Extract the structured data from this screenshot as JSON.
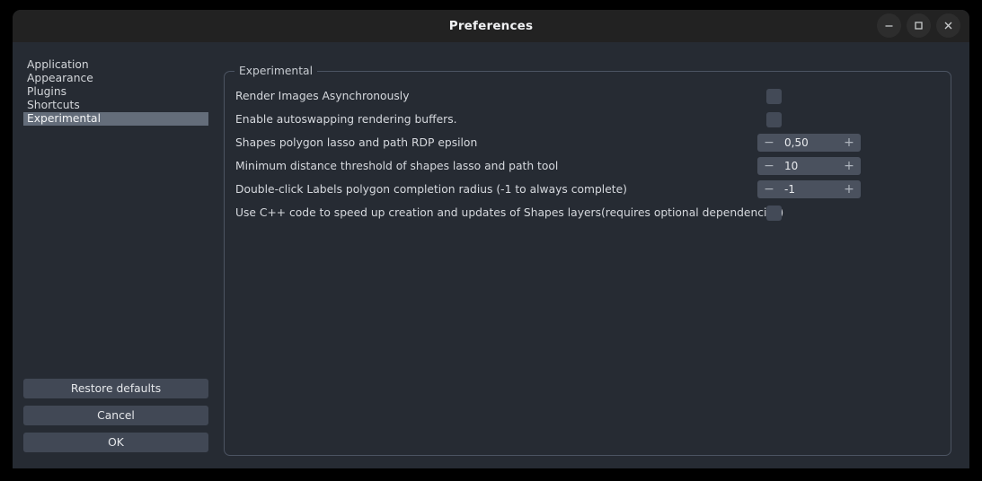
{
  "window": {
    "title": "Preferences",
    "controls": [
      {
        "name": "minimize",
        "glyph": "minimize-icon"
      },
      {
        "name": "maximize",
        "glyph": "maximize-icon"
      },
      {
        "name": "close",
        "glyph": "close-icon"
      }
    ]
  },
  "sidebar": {
    "items": [
      {
        "label": "Application",
        "selected": false
      },
      {
        "label": "Appearance",
        "selected": false
      },
      {
        "label": "Plugins",
        "selected": false
      },
      {
        "label": "Shortcuts",
        "selected": false
      },
      {
        "label": "Experimental",
        "selected": true
      }
    ]
  },
  "buttons": {
    "restore_defaults": "Restore defaults",
    "cancel": "Cancel",
    "ok": "OK"
  },
  "group": {
    "title": "Experimental",
    "rows": [
      {
        "label": "Render Images Asynchronously",
        "control": "checkbox",
        "checked": false
      },
      {
        "label": "Enable autoswapping rendering buffers.",
        "control": "checkbox",
        "checked": false
      },
      {
        "label": "Shapes polygon lasso and path RDP epsilon",
        "control": "spinbox",
        "value": "0,50",
        "decrement": "−",
        "increment": "+"
      },
      {
        "label": "Minimum distance threshold of shapes lasso and path tool",
        "control": "spinbox",
        "value": "10",
        "decrement": "−",
        "increment": "+"
      },
      {
        "label": "Double-click Labels polygon completion radius (-1 to always complete)",
        "control": "spinbox",
        "value": "-1",
        "decrement": "−",
        "increment": "+"
      },
      {
        "label": "Use C++ code to speed up creation and updates of Shapes layers(requires optional dependencies)",
        "control": "checkbox",
        "checked": false
      }
    ]
  },
  "colors": {
    "window_bg": "#262b33",
    "titlebar_bg": "#222222",
    "selection": "#646d7a",
    "button_bg": "#414855",
    "control_bg": "#434a57",
    "spin_bg": "#4a515e",
    "border": "#4c5462",
    "text": "#d6d9de"
  }
}
